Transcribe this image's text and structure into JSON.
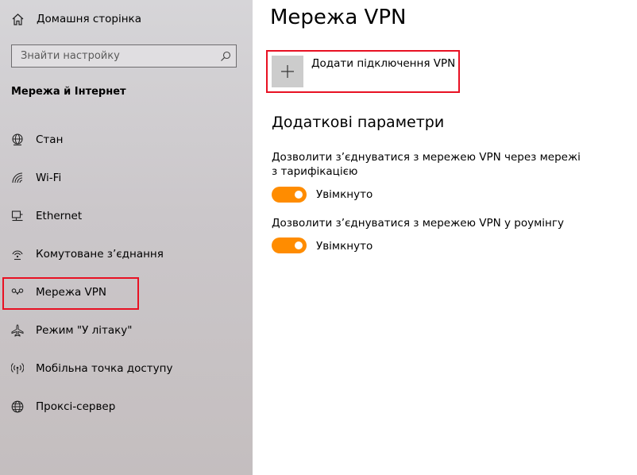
{
  "sidebar": {
    "home_label": "Домашня сторінка",
    "search_placeholder": "Знайти настройку",
    "section_title": "Мережа й Інтернет",
    "items": [
      {
        "label": "Стан",
        "icon": "globe-status-icon"
      },
      {
        "label": "Wi-Fi",
        "icon": "wifi-icon"
      },
      {
        "label": "Ethernet",
        "icon": "ethernet-icon"
      },
      {
        "label": "Комутоване з’єднання",
        "icon": "dialup-icon"
      },
      {
        "label": "Мережа VPN",
        "icon": "vpn-icon",
        "selected": true
      },
      {
        "label": "Режим \"У літаку\"",
        "icon": "airplane-icon"
      },
      {
        "label": "Мобільна точка доступу",
        "icon": "hotspot-icon"
      },
      {
        "label": "Проксі-сервер",
        "icon": "globe-icon"
      }
    ]
  },
  "main": {
    "title": "Мережа VPN",
    "add_vpn_label": "Додати підключення VPN",
    "advanced_heading": "Додаткові параметри",
    "settings": [
      {
        "text": "Дозволити з’єднуватися з мережею VPN через мережі з тарифікацією",
        "toggle_label": "Увімкнуто",
        "on": true
      },
      {
        "text": "Дозволити з’єднуватися з мережею VPN у роумінгу",
        "toggle_label": "Увімкнуто",
        "on": true
      }
    ]
  },
  "colors": {
    "accent": "#ff8c00",
    "highlight": "#e81123",
    "sidebar_bg": "#cbc7ca",
    "main_bg": "#ffffff"
  }
}
